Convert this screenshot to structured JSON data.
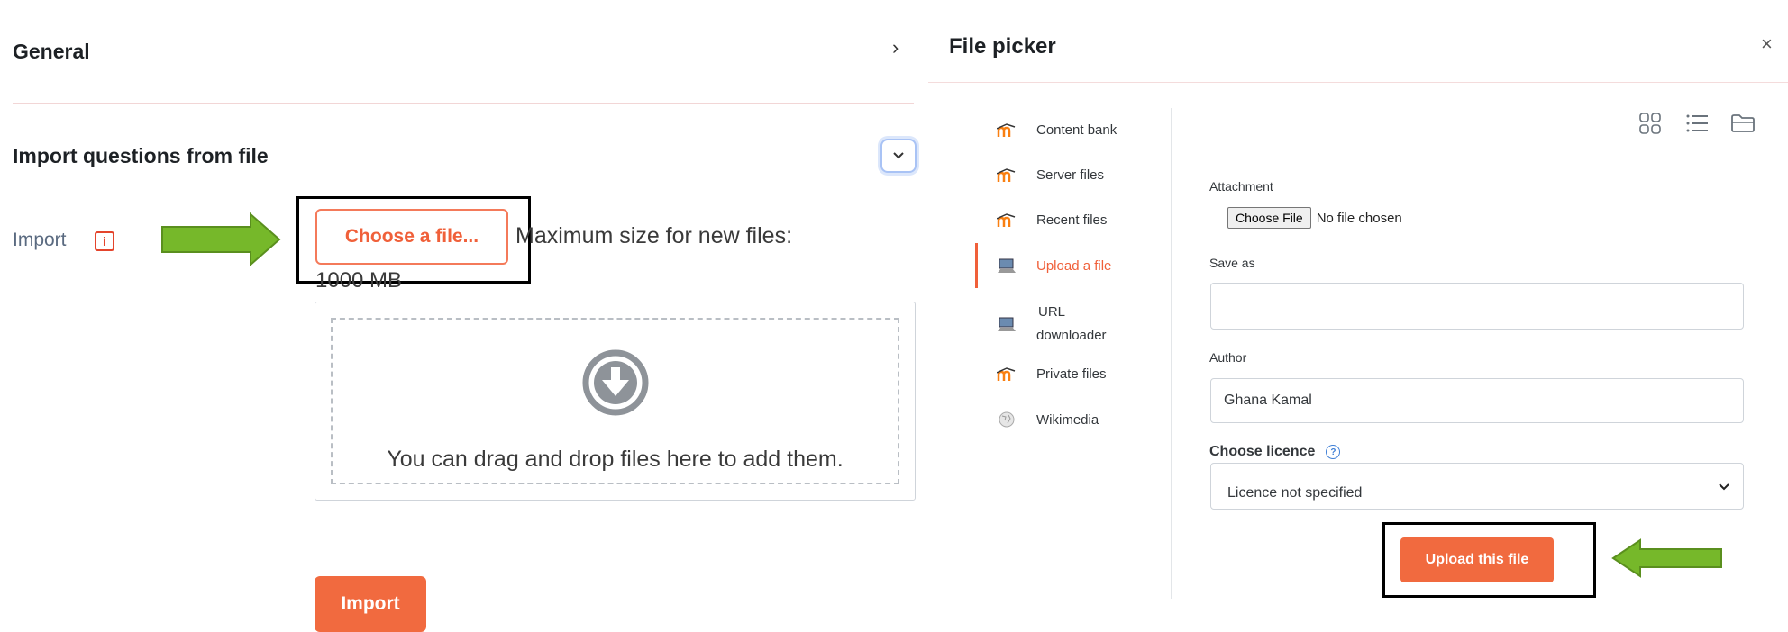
{
  "left": {
    "general_title": "General",
    "section_title": "Import questions from file",
    "import_label": "Import",
    "choose_file_label": "Choose a file...",
    "max_size_text": "Maximum size for new files:",
    "max_size_value": "1000 MB",
    "drop_text": "You can drag and drop files here to add them.",
    "import_button": "Import"
  },
  "file_picker": {
    "title": "File picker",
    "repositories": [
      {
        "label": "Content bank"
      },
      {
        "label": "Server files"
      },
      {
        "label": "Recent files"
      },
      {
        "label": "Upload a file",
        "active": true
      },
      {
        "label_line1": "URL",
        "label_line2": "downloader"
      },
      {
        "label": "Private files"
      },
      {
        "label": "Wikimedia"
      }
    ],
    "attachment_label": "Attachment",
    "choose_file_button": "Choose File",
    "no_file_text": "No file chosen",
    "save_as_label": "Save as",
    "save_as_value": "",
    "author_label": "Author",
    "author_value": "Ghana Kamal",
    "licence_label": "Choose licence",
    "licence_value": "Licence not specified",
    "upload_button": "Upload this file"
  },
  "colors": {
    "accent": "#f16a3f",
    "arrow_green": "#76b82a",
    "border_black": "#000000"
  }
}
